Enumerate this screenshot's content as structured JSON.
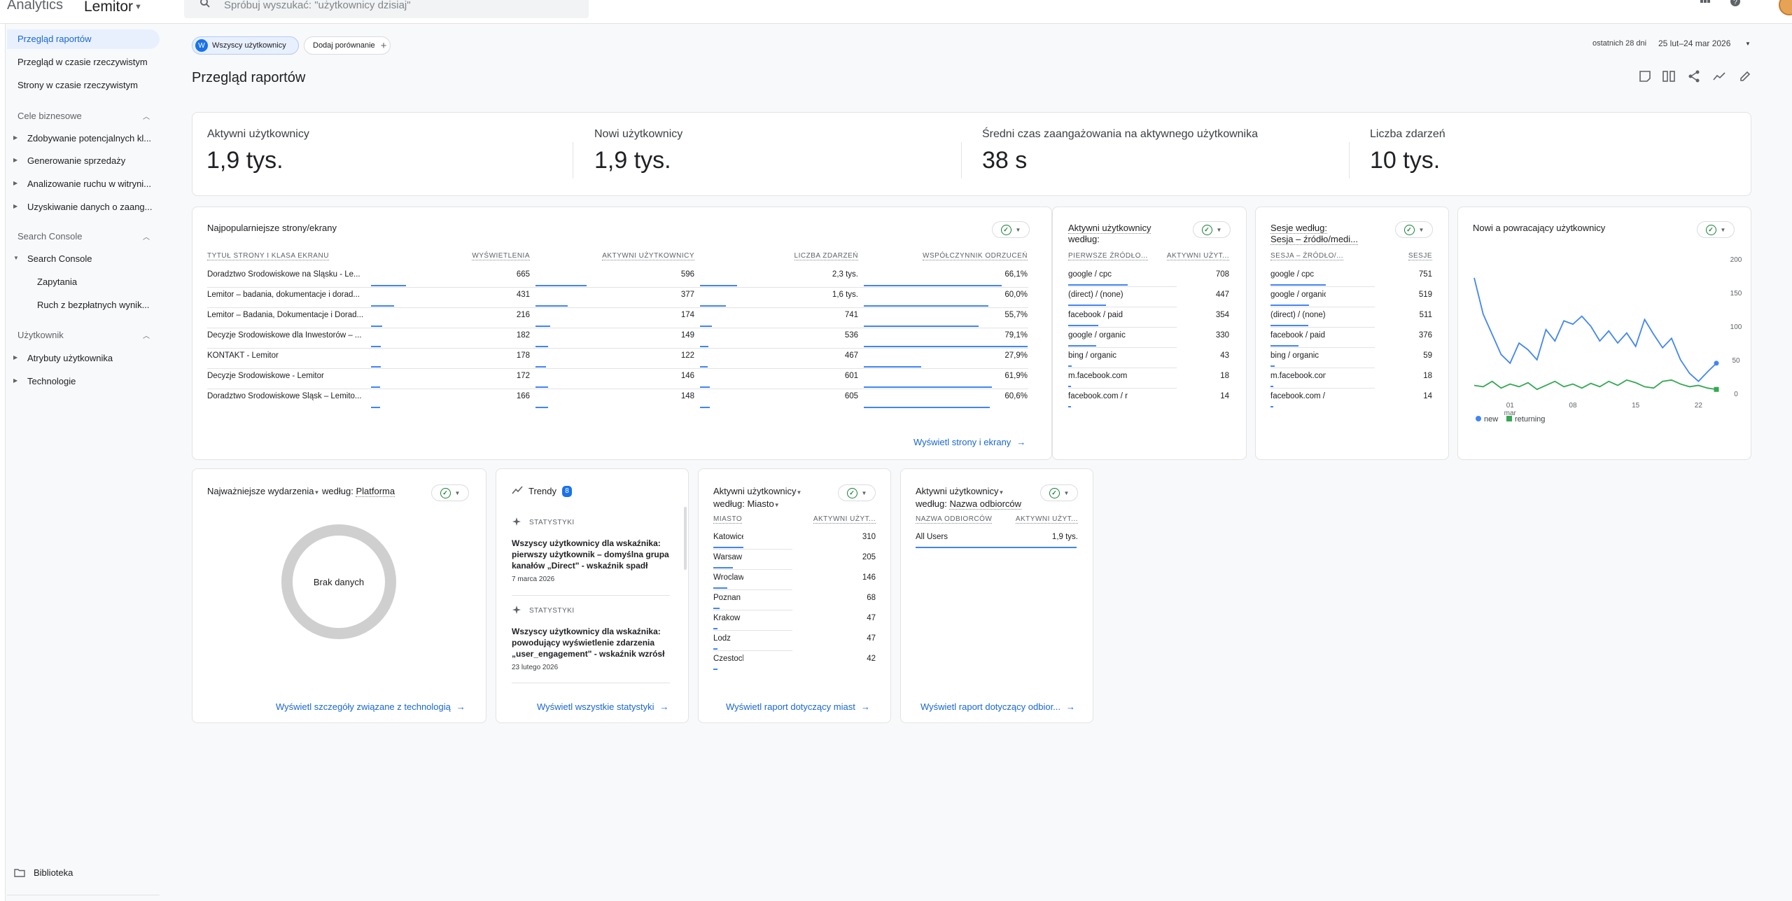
{
  "topbar": {
    "brand": "Analytics",
    "property": "Lemitor",
    "search_placeholder": "Spróbuj wyszukać: \"użytkownicy dzisiaj\""
  },
  "sidebar": {
    "active": "Przegląd raportów",
    "items": [
      "Przegląd w czasie rzeczywistym",
      "Strony w czasie rzeczywistym"
    ],
    "sections": [
      {
        "title": "Cele biznesowe",
        "items": [
          "Zdobywanie potencjalnych kl...",
          "Generowanie sprzedaży",
          "Analizowanie ruchu w witryni...",
          "Uzyskiwanie danych o zaang..."
        ]
      },
      {
        "title": "Search Console",
        "items": [
          "Search Console"
        ],
        "subitems": [
          "Zapytania",
          "Ruch z bezpłatnych wynik..."
        ]
      },
      {
        "title": "Użytkownik",
        "items": [
          "Atrybuty użytkownika",
          "Technologie"
        ]
      }
    ],
    "library": "Biblioteka"
  },
  "filters": {
    "all_users_letter": "W",
    "all_users": "Wszyscy użytkownicy",
    "add_comparison": "Dodaj porównanie",
    "date_prefix": "ostatnich 28 dni",
    "date_range": "25 lut–24 mar 2026"
  },
  "page_title": "Przegląd raportów",
  "kpis": [
    {
      "label": "Aktywni użytkownicy",
      "value": "1,9 tys."
    },
    {
      "label": "Nowi użytkownicy",
      "value": "1,9 tys."
    },
    {
      "label": "Średni czas zaangażowania na aktywnego użytkownika",
      "value": "38 s"
    },
    {
      "label": "Liczba zdarzeń",
      "value": "10 tys."
    }
  ],
  "top_pages": {
    "title": "Najpopularniejsze strony/ekrany",
    "headers": [
      "TYTUŁ STRONY I KLASA EKRANU",
      "WYŚWIETLENIA",
      "AKTYWNI UŻYTKOWNICY",
      "LICZBA ZDARZEŃ",
      "WSPÓŁCZYNNIK ODRZUCEŃ"
    ],
    "rows": [
      {
        "title": "Doradztwo Środowiskowe na Śląsku - Le...",
        "views": "665",
        "views_f": 1.0,
        "users": "596",
        "users_f": 1.0,
        "events": "2,3 tys.",
        "events_f": 1.0,
        "bounce": "66,1%",
        "bounce_f": 0.84
      },
      {
        "title": "Lemitor – badania, dokumentacje i dorad...",
        "views": "431",
        "views_f": 0.65,
        "users": "377",
        "users_f": 0.63,
        "events": "1,6 tys.",
        "events_f": 0.7,
        "bounce": "60,0%",
        "bounce_f": 0.76
      },
      {
        "title": "Lemitor – Badania, Dokumentacje i Dorad...",
        "views": "216",
        "views_f": 0.32,
        "users": "174",
        "users_f": 0.29,
        "events": "741",
        "events_f": 0.32,
        "bounce": "55,7%",
        "bounce_f": 0.7
      },
      {
        "title": "Decyzje Środowiskowe dla Inwestorów – ...",
        "views": "182",
        "views_f": 0.27,
        "users": "149",
        "users_f": 0.25,
        "events": "536",
        "events_f": 0.23,
        "bounce": "79,1%",
        "bounce_f": 1.0
      },
      {
        "title": "KONTAKT - Lemitor",
        "views": "178",
        "views_f": 0.27,
        "users": "122",
        "users_f": 0.2,
        "events": "467",
        "events_f": 0.2,
        "bounce": "27,9%",
        "bounce_f": 0.35
      },
      {
        "title": "Decyzje Środowiskowe - Lemitor",
        "views": "172",
        "views_f": 0.26,
        "users": "146",
        "users_f": 0.24,
        "events": "601",
        "events_f": 0.26,
        "bounce": "61,9%",
        "bounce_f": 0.78
      },
      {
        "title": "Doradztwo Środowiskowe Śląsk – Lemito...",
        "views": "166",
        "views_f": 0.25,
        "users": "148",
        "users_f": 0.25,
        "events": "605",
        "events_f": 0.26,
        "bounce": "60,6%",
        "bounce_f": 0.77
      }
    ],
    "link": "Wyświetl strony i ekrany"
  },
  "first_source": {
    "title_line1": "Aktywni użytkownicy",
    "title_line2": "według:",
    "headers": [
      "PIERWSZE ŹRÓDŁO...",
      "AKTYWNI UŻYT..."
    ],
    "rows": [
      {
        "name": "google / cpc",
        "value": "708",
        "f": 1.0
      },
      {
        "name": "(direct) / (none)",
        "value": "447",
        "f": 0.63
      },
      {
        "name": "facebook / paid",
        "value": "354",
        "f": 0.5
      },
      {
        "name": "google / organic",
        "value": "330",
        "f": 0.47
      },
      {
        "name": "bing / organic",
        "value": "43",
        "f": 0.06
      },
      {
        "name": "m.facebook.com / re...",
        "value": "18",
        "f": 0.03
      },
      {
        "name": "facebook.com / refer...",
        "value": "14",
        "f": 0.02
      }
    ]
  },
  "sessions_source": {
    "title_line1": "Sesje według:",
    "title_line2": "Sesja – źródło/medi...",
    "headers": [
      "SESJA – ŹRÓDŁO/...",
      "SESJE"
    ],
    "rows": [
      {
        "name": "google / cpc",
        "value": "751",
        "f": 1.0
      },
      {
        "name": "google / organic",
        "value": "519",
        "f": 0.69
      },
      {
        "name": "(direct) / (none)",
        "value": "511",
        "f": 0.68
      },
      {
        "name": "facebook / paid",
        "value": "376",
        "f": 0.5
      },
      {
        "name": "bing / organic",
        "value": "59",
        "f": 0.08
      },
      {
        "name": "m.facebook.com / re...",
        "value": "18",
        "f": 0.03
      },
      {
        "name": "facebook.com / refer...",
        "value": "14",
        "f": 0.02
      }
    ]
  },
  "chart_data": {
    "type": "line",
    "title": "Nowi a powracający użytkownicy",
    "x_ticks": [
      "01",
      "08",
      "15",
      "22"
    ],
    "x_tick_sub": "mar",
    "ylim": [
      0,
      200
    ],
    "y_ticks": [
      0,
      50,
      100,
      150,
      200
    ],
    "legend_position": "bottom-left",
    "series": [
      {
        "name": "new",
        "color": "#4285f4",
        "values": [
          172,
          118,
          88,
          58,
          45,
          75,
          65,
          50,
          95,
          78,
          108,
          103,
          115,
          100,
          78,
          93,
          75,
          90,
          70,
          110,
          88,
          68,
          82,
          50,
          30,
          18,
          32,
          45
        ]
      },
      {
        "name": "returning",
        "color": "#34a853",
        "values": [
          12,
          10,
          18,
          8,
          14,
          10,
          16,
          6,
          12,
          18,
          10,
          14,
          8,
          15,
          10,
          18,
          12,
          20,
          16,
          10,
          8,
          18,
          20,
          14,
          10,
          12,
          8,
          6
        ]
      }
    ]
  },
  "events_card": {
    "title": "Najważniejsze wydarzenia",
    "by": "według:",
    "dim": "Platforma",
    "no_data": "Brak danych",
    "link": "Wyświetl szczegóły związane z technologią"
  },
  "trends": {
    "title": "Trendy",
    "badge": "8",
    "items": [
      {
        "label": "STATYSTYKI",
        "text": "Wszyscy użytkownicy dla wskaźnika: pierwszy użytkownik – domyślna grupa kanałów „Direct\" - wskaźnik spadł",
        "date": "7 marca 2026"
      },
      {
        "label": "STATYSTYKI",
        "text": "Wszyscy użytkownicy dla wskaźnika: powodujący wyświetlenie zdarzenia „user_engagement\" - wskaźnik wzrósł",
        "date": "23 lutego 2026"
      }
    ],
    "link": "Wyświetl wszystkie statystyki"
  },
  "city": {
    "title_line1": "Aktywni użytkownicy",
    "title_line2": "według:",
    "dim": "Miasto",
    "headers": [
      "MIASTO",
      "AKTYWNI UŻYT..."
    ],
    "rows": [
      {
        "name": "Katowice",
        "value": "310",
        "f": 1.0
      },
      {
        "name": "Warsaw",
        "value": "205",
        "f": 0.66
      },
      {
        "name": "Wroclaw",
        "value": "146",
        "f": 0.47
      },
      {
        "name": "Poznan",
        "value": "68",
        "f": 0.22
      },
      {
        "name": "Krakow",
        "value": "47",
        "f": 0.15
      },
      {
        "name": "Lodz",
        "value": "47",
        "f": 0.15
      },
      {
        "name": "Czestochowa",
        "value": "42",
        "f": 0.14
      }
    ],
    "link": "Wyświetl raport dotyczący miast"
  },
  "audience": {
    "title_line1": "Aktywni użytkownicy",
    "title_line2": "według:",
    "dim": "Nazwa odbiorców",
    "headers": [
      "NAZWA ODBIORCÓW",
      "AKTYWNI UŻYT..."
    ],
    "rows": [
      {
        "name": "All Users",
        "value": "1,9 tys.",
        "f": 1.0
      }
    ],
    "link": "Wyświetl raport dotyczący odbior..."
  }
}
